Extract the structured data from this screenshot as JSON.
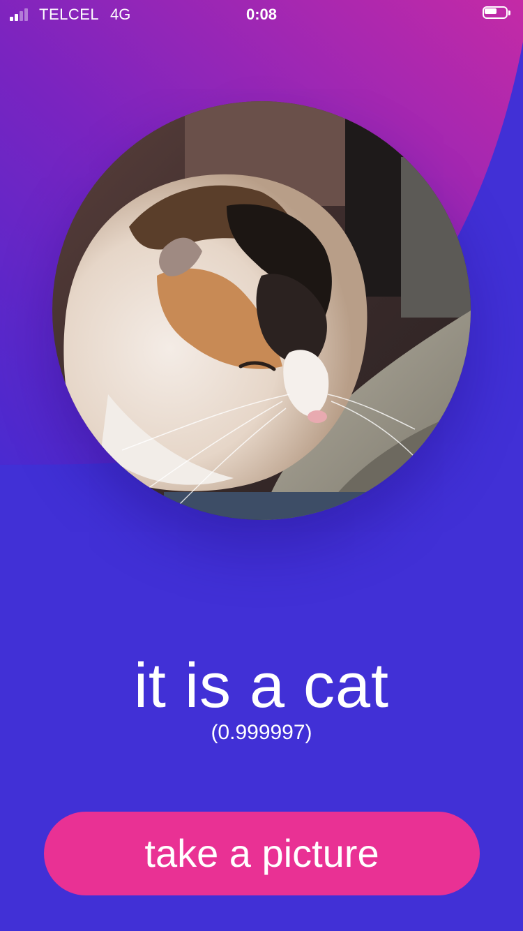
{
  "status_bar": {
    "carrier": "TELCEL",
    "network": "4G",
    "time": "0:08",
    "signal_bars_filled": 2,
    "signal_bars_total": 4,
    "battery_level": 0.55
  },
  "photo": {
    "subject_icon": "calico-cat-photo"
  },
  "result": {
    "label": "it is a cat",
    "confidence": "(0.999997)"
  },
  "actions": {
    "take_picture_label": "take a picture"
  },
  "colors": {
    "background": "#4130d6",
    "gradient_top": "#6b22c4",
    "gradient_accent": "#c22aa8",
    "button": "#e93194",
    "text": "#ffffff"
  }
}
